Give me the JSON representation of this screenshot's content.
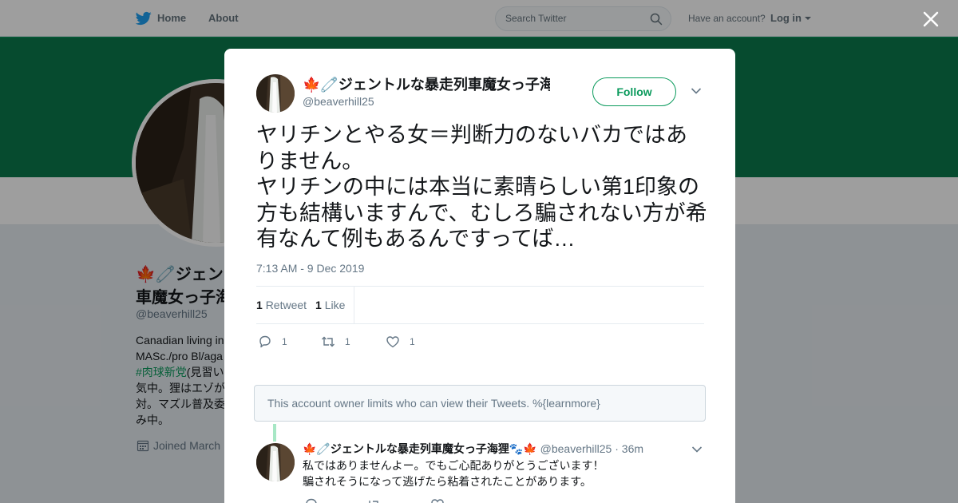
{
  "nav": {
    "home_label": "Home",
    "about_label": "About",
    "search_placeholder": "Search Twitter",
    "have_account": "Have an account?",
    "login_label": "Log in"
  },
  "profile_bg": {
    "name_line1": "🍁🧷ジェン",
    "name_line2": "車魔女っ子海",
    "handle": "@beaverhill25",
    "bio_lines": [
      "Canadian living in",
      "MASc./pro Bl/aga",
      "(見習い",
      "気中。狸はエゾが",
      "対。マズル普及委",
      "み中。"
    ],
    "hashtag": "#肉球新党",
    "joined": "Joined March"
  },
  "tweet": {
    "author_name": "🍁🧷ジェントルな暴走列車魔女っ子海狸🐾🍁",
    "author_handle": "@beaverhill25",
    "follow_label": "Follow",
    "text": "ヤリチンとやる女＝判断力のないバカではありません。\nヤリチンの中には本当に素晴らしい第1印象の方も結構いますんで、むしろ騙されない方が希有なんて例もあるんですってば…",
    "timestamp": "7:13 AM - 9 Dec 2019",
    "retweet_count": "1",
    "retweet_label": "Retweet",
    "like_count": "1",
    "like_label": "Like",
    "reply_count": "1",
    "retweet_action_count": "1",
    "like_action_count": "1"
  },
  "notice": {
    "text": "This account owner limits who can view their Tweets. %{learnmore}"
  },
  "reply": {
    "author_name": "🍁🧷ジェントルな暴走列車魔女っ子海狸🐾🍁",
    "author_handle": "@beaverhill25",
    "separator": "·",
    "time": "36m",
    "text_line1": "私ではありませんよー。でもご心配ありがとうございます！",
    "text_line2": "騙されそうになって逃げたら粘着されたことがあります。"
  },
  "colors": {
    "accent": "#0a9a5c",
    "banner": "#0a7a4c",
    "twitter_blue": "#1da1f2"
  }
}
